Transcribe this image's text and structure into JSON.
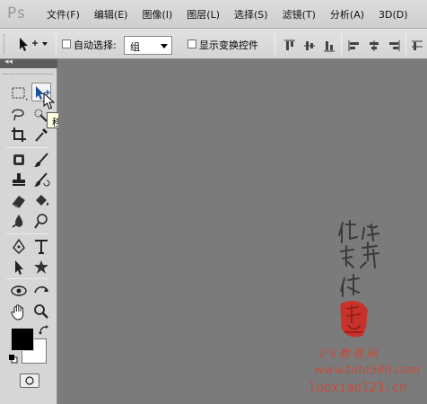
{
  "app": {
    "logo": "Ps"
  },
  "menu": [
    "文件(F)",
    "编辑(E)",
    "图像(I)",
    "图层(L)",
    "选择(S)",
    "滤镜(T)",
    "分析(A)",
    "3D(D)"
  ],
  "options": {
    "auto_select_label": "自动选择:",
    "auto_select_value": "组",
    "show_transform_label": "显示变换控件"
  },
  "toolbox": {
    "collapse_glyph": "◂◂"
  },
  "tooltip": {
    "text": "移动工具 (V)"
  },
  "watermark": {
    "calligraphy": [
      "他",
      "她",
      "我",
      "华",
      "你"
    ],
    "brand": "PS教程网",
    "site1": "www.tata580.com",
    "site2": "luoxiao123.cn"
  },
  "colors": {
    "foreground": "#000000",
    "background": "#ffffff",
    "seal": "#c8322a",
    "watermark_text": "#c94a3a"
  }
}
